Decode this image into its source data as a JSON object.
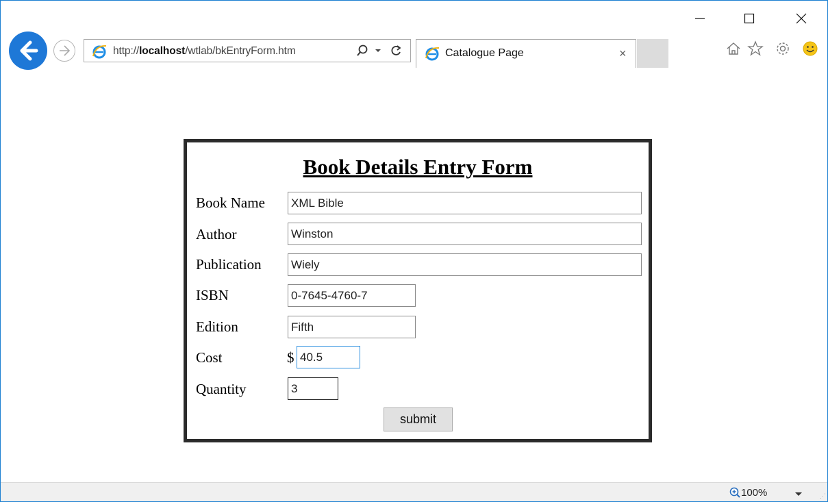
{
  "browser": {
    "url": {
      "prefix": "http://",
      "host": "localhost",
      "path": "/wtlab/bkEntryForm.htm"
    },
    "tab": {
      "title": "Catalogue Page",
      "close": "×"
    },
    "status": {
      "zoom": "100%"
    }
  },
  "form": {
    "title": "Book Details Entry Form",
    "fields": [
      {
        "label": "Book Name",
        "value": "XML Bible"
      },
      {
        "label": "Author",
        "value": "Winston"
      },
      {
        "label": "Publication",
        "value": "Wiely"
      },
      {
        "label": "ISBN",
        "value": "0-7645-4760-7"
      },
      {
        "label": "Edition",
        "value": "Fifth"
      },
      {
        "label": "Cost",
        "value": "40.5"
      },
      {
        "label": "Quantity",
        "value": "3"
      }
    ],
    "currency_symbol": "$",
    "submit_label": "submit"
  }
}
